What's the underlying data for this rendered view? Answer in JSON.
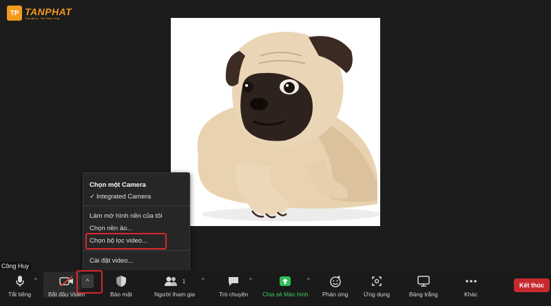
{
  "logo": {
    "mark": "TP",
    "name": "TANPHAT",
    "tagline": "Trao giá trị - Tạo thành công"
  },
  "participant": {
    "name": "Công Huy"
  },
  "menu": {
    "title": "Chọn một Camera",
    "camera_selected": "Integrated Camera",
    "blur_background": "Làm mờ hình nền của tôi",
    "choose_background": "Chọn nền ảo...",
    "choose_video_filter": "Chọn bộ lọc video...",
    "video_settings": "Cài đặt video..."
  },
  "toolbar": {
    "mute_label": "Tắt tiếng",
    "start_video_label": "Bắt đầu Video",
    "security_label": "Bảo mật",
    "participants_label": "Người tham gia",
    "participants_count": "1",
    "chat_label": "Trò chuyện",
    "share_screen_label": "Chia sẻ Màn hình",
    "reactions_label": "Phản ứng",
    "apps_label": "Ứng dụng",
    "whiteboard_label": "Bảng trắng",
    "more_label": "Khác",
    "end_label": "Kết thúc",
    "caret": "^"
  },
  "colors": {
    "background": "#1c1c1c",
    "menu_bg": "#262626",
    "highlight_red": "#d8282d",
    "end_red": "#c62a2f",
    "share_green": "#3fd16b",
    "brand_orange": "#f29a1f"
  }
}
